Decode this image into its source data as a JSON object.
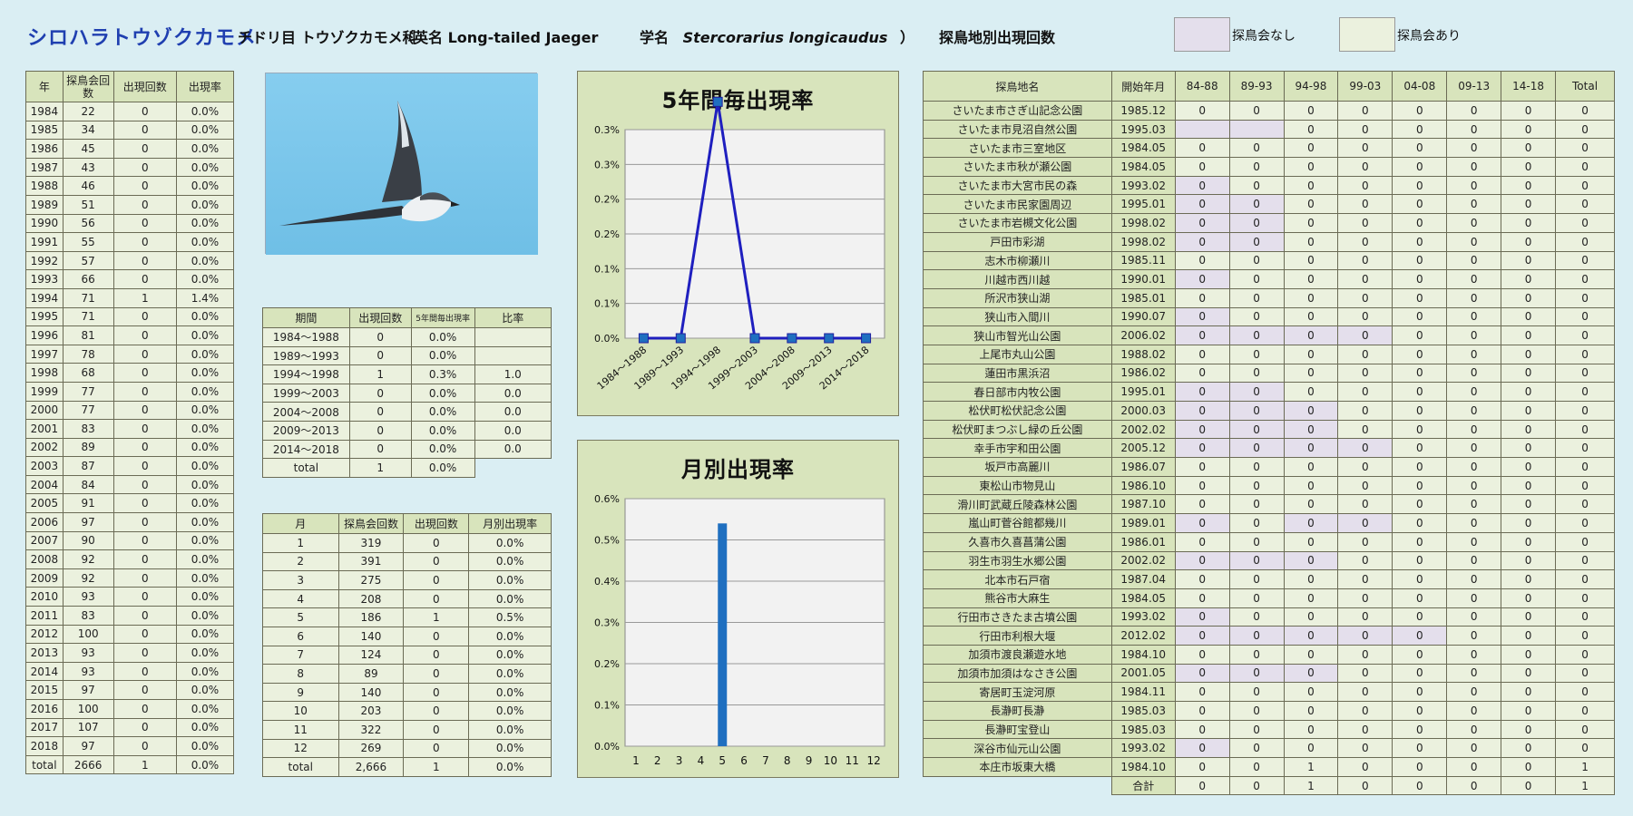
{
  "header": {
    "title": "シロハラトウゾクカモメ",
    "order": "チドリ目 トウゾクカモメ科",
    "english_prefix": "（英名 Long-tailed Jaeger",
    "scientific_prefix": "学名",
    "scientific_name": "Stercorarius longicaudus",
    "scientific_suffix": "）",
    "site_section_title": "探鳥地別出現回数",
    "legend_no_meeting": "探鳥会なし",
    "legend_meeting": "探鳥会あり"
  },
  "colors": {
    "header_green": "#d8e4bc",
    "body_green": "#ebf1de",
    "no_meeting_purple": "#e4dfec",
    "line_blue": "#1f1fbf",
    "bar_blue": "#1f6fc0",
    "background": "#daeef3"
  },
  "year_table": {
    "headers": [
      "年",
      "探鳥会回数",
      "出現回数",
      "出現率"
    ],
    "rows": [
      [
        "1984",
        "22",
        "0",
        "0.0%"
      ],
      [
        "1985",
        "34",
        "0",
        "0.0%"
      ],
      [
        "1986",
        "45",
        "0",
        "0.0%"
      ],
      [
        "1987",
        "43",
        "0",
        "0.0%"
      ],
      [
        "1988",
        "46",
        "0",
        "0.0%"
      ],
      [
        "1989",
        "51",
        "0",
        "0.0%"
      ],
      [
        "1990",
        "56",
        "0",
        "0.0%"
      ],
      [
        "1991",
        "55",
        "0",
        "0.0%"
      ],
      [
        "1992",
        "57",
        "0",
        "0.0%"
      ],
      [
        "1993",
        "66",
        "0",
        "0.0%"
      ],
      [
        "1994",
        "71",
        "1",
        "1.4%"
      ],
      [
        "1995",
        "71",
        "0",
        "0.0%"
      ],
      [
        "1996",
        "81",
        "0",
        "0.0%"
      ],
      [
        "1997",
        "78",
        "0",
        "0.0%"
      ],
      [
        "1998",
        "68",
        "0",
        "0.0%"
      ],
      [
        "1999",
        "77",
        "0",
        "0.0%"
      ],
      [
        "2000",
        "77",
        "0",
        "0.0%"
      ],
      [
        "2001",
        "83",
        "0",
        "0.0%"
      ],
      [
        "2002",
        "89",
        "0",
        "0.0%"
      ],
      [
        "2003",
        "87",
        "0",
        "0.0%"
      ],
      [
        "2004",
        "84",
        "0",
        "0.0%"
      ],
      [
        "2005",
        "91",
        "0",
        "0.0%"
      ],
      [
        "2006",
        "97",
        "0",
        "0.0%"
      ],
      [
        "2007",
        "90",
        "0",
        "0.0%"
      ],
      [
        "2008",
        "92",
        "0",
        "0.0%"
      ],
      [
        "2009",
        "92",
        "0",
        "0.0%"
      ],
      [
        "2010",
        "93",
        "0",
        "0.0%"
      ],
      [
        "2011",
        "83",
        "0",
        "0.0%"
      ],
      [
        "2012",
        "100",
        "0",
        "0.0%"
      ],
      [
        "2013",
        "93",
        "0",
        "0.0%"
      ],
      [
        "2014",
        "93",
        "0",
        "0.0%"
      ],
      [
        "2015",
        "97",
        "0",
        "0.0%"
      ],
      [
        "2016",
        "100",
        "0",
        "0.0%"
      ],
      [
        "2017",
        "107",
        "0",
        "0.0%"
      ],
      [
        "2018",
        "97",
        "0",
        "0.0%"
      ],
      [
        "total",
        "2666",
        "1",
        "0.0%"
      ]
    ]
  },
  "period_table": {
    "headers": [
      "期間",
      "出現回数",
      "5年間毎出現率",
      "比率"
    ],
    "rows": [
      [
        "1984～1988",
        "0",
        "0.0%",
        ""
      ],
      [
        "1989～1993",
        "0",
        "0.0%",
        ""
      ],
      [
        "1994～1998",
        "1",
        "0.3%",
        "1.0"
      ],
      [
        "1999～2003",
        "0",
        "0.0%",
        "0.0"
      ],
      [
        "2004～2008",
        "0",
        "0.0%",
        "0.0"
      ],
      [
        "2009～2013",
        "0",
        "0.0%",
        "0.0"
      ],
      [
        "2014～2018",
        "0",
        "0.0%",
        "0.0"
      ]
    ],
    "total": [
      "total",
      "1",
      "0.0%"
    ]
  },
  "month_table": {
    "headers": [
      "月",
      "探鳥会回数",
      "出現回数",
      "月別出現率"
    ],
    "rows": [
      [
        "1",
        "319",
        "0",
        "0.0%"
      ],
      [
        "2",
        "391",
        "0",
        "0.0%"
      ],
      [
        "3",
        "275",
        "0",
        "0.0%"
      ],
      [
        "4",
        "208",
        "0",
        "0.0%"
      ],
      [
        "5",
        "186",
        "1",
        "0.5%"
      ],
      [
        "6",
        "140",
        "0",
        "0.0%"
      ],
      [
        "7",
        "124",
        "0",
        "0.0%"
      ],
      [
        "8",
        "89",
        "0",
        "0.0%"
      ],
      [
        "9",
        "140",
        "0",
        "0.0%"
      ],
      [
        "10",
        "203",
        "0",
        "0.0%"
      ],
      [
        "11",
        "322",
        "0",
        "0.0%"
      ],
      [
        "12",
        "269",
        "0",
        "0.0%"
      ],
      [
        "total",
        "2,666",
        "1",
        "0.0%"
      ]
    ]
  },
  "chart_data": [
    {
      "type": "line",
      "title": "5年間毎出現率",
      "categories": [
        "1984～1988",
        "1989～1993",
        "1994～1998",
        "1999～2003",
        "2004～2008",
        "2009～2013",
        "2014～2018"
      ],
      "values": [
        0.0,
        0.0,
        0.34,
        0.0,
        0.0,
        0.0,
        0.0
      ],
      "ylim": [
        0,
        0.3
      ],
      "yticks": [
        "0.0%",
        "0.1%",
        "0.1%",
        "0.2%",
        "0.2%",
        "0.3%",
        "0.3%"
      ],
      "ytick_values": [
        0,
        0.05,
        0.1,
        0.15,
        0.2,
        0.25,
        0.3
      ],
      "grid": true,
      "xlabel": "",
      "ylabel": ""
    },
    {
      "type": "bar",
      "title": "月別出現率",
      "categories": [
        "1",
        "2",
        "3",
        "4",
        "5",
        "6",
        "7",
        "8",
        "9",
        "10",
        "11",
        "12"
      ],
      "values": [
        0,
        0,
        0,
        0,
        0.54,
        0,
        0,
        0,
        0,
        0,
        0,
        0
      ],
      "ylim": [
        0,
        0.6
      ],
      "yticks": [
        "0.0%",
        "0.1%",
        "0.2%",
        "0.3%",
        "0.4%",
        "0.5%",
        "0.6%"
      ],
      "ytick_values": [
        0,
        0.1,
        0.2,
        0.3,
        0.4,
        0.5,
        0.6
      ],
      "grid": true,
      "xlabel": "",
      "ylabel": ""
    }
  ],
  "site_table": {
    "headers": [
      "探鳥地名",
      "開始年月",
      "84-88",
      "89-93",
      "94-98",
      "99-03",
      "04-08",
      "09-13",
      "14-18",
      "Total"
    ],
    "rows": [
      {
        "name": "さいたま市さぎ山記念公園",
        "start": "1985.12",
        "v": [
          "0",
          "0",
          "0",
          "0",
          "0",
          "0",
          "0",
          "0"
        ],
        "p": []
      },
      {
        "name": "さいたま市見沼自然公園",
        "start": "1995.03",
        "v": [
          "",
          "",
          "0",
          "0",
          "0",
          "0",
          "0",
          "0"
        ],
        "p": [
          0,
          1
        ]
      },
      {
        "name": "さいたま市三室地区",
        "start": "1984.05",
        "v": [
          "0",
          "0",
          "0",
          "0",
          "0",
          "0",
          "0",
          "0"
        ],
        "p": []
      },
      {
        "name": "さいたま市秋が瀬公園",
        "start": "1984.05",
        "v": [
          "0",
          "0",
          "0",
          "0",
          "0",
          "0",
          "0",
          "0"
        ],
        "p": []
      },
      {
        "name": "さいたま市大宮市民の森",
        "start": "1993.02",
        "v": [
          "0",
          "0",
          "0",
          "0",
          "0",
          "0",
          "0",
          "0"
        ],
        "p": [
          0
        ]
      },
      {
        "name": "さいたま市民家園周辺",
        "start": "1995.01",
        "v": [
          "0",
          "0",
          "0",
          "0",
          "0",
          "0",
          "0",
          "0"
        ],
        "p": [
          0,
          1
        ]
      },
      {
        "name": "さいたま市岩槻文化公園",
        "start": "1998.02",
        "v": [
          "0",
          "0",
          "0",
          "0",
          "0",
          "0",
          "0",
          "0"
        ],
        "p": [
          0,
          1
        ]
      },
      {
        "name": "戸田市彩湖",
        "start": "1998.02",
        "v": [
          "0",
          "0",
          "0",
          "0",
          "0",
          "0",
          "0",
          "0"
        ],
        "p": [
          0,
          1
        ]
      },
      {
        "name": "志木市柳瀬川",
        "start": "1985.11",
        "v": [
          "0",
          "0",
          "0",
          "0",
          "0",
          "0",
          "0",
          "0"
        ],
        "p": []
      },
      {
        "name": "川越市西川越",
        "start": "1990.01",
        "v": [
          "0",
          "0",
          "0",
          "0",
          "0",
          "0",
          "0",
          "0"
        ],
        "p": [
          0
        ]
      },
      {
        "name": "所沢市狭山湖",
        "start": "1985.01",
        "v": [
          "0",
          "0",
          "0",
          "0",
          "0",
          "0",
          "0",
          "0"
        ],
        "p": []
      },
      {
        "name": "狭山市入間川",
        "start": "1990.07",
        "v": [
          "0",
          "0",
          "0",
          "0",
          "0",
          "0",
          "0",
          "0"
        ],
        "p": [
          0
        ]
      },
      {
        "name": "狭山市智光山公園",
        "start": "2006.02",
        "v": [
          "0",
          "0",
          "0",
          "0",
          "0",
          "0",
          "0",
          "0"
        ],
        "p": [
          0,
          1,
          2,
          3
        ]
      },
      {
        "name": "上尾市丸山公園",
        "start": "1988.02",
        "v": [
          "0",
          "0",
          "0",
          "0",
          "0",
          "0",
          "0",
          "0"
        ],
        "p": []
      },
      {
        "name": "蓮田市黒浜沼",
        "start": "1986.02",
        "v": [
          "0",
          "0",
          "0",
          "0",
          "0",
          "0",
          "0",
          "0"
        ],
        "p": []
      },
      {
        "name": "春日部市内牧公園",
        "start": "1995.01",
        "v": [
          "0",
          "0",
          "0",
          "0",
          "0",
          "0",
          "0",
          "0"
        ],
        "p": [
          0,
          1
        ]
      },
      {
        "name": "松伏町松伏記念公園",
        "start": "2000.03",
        "v": [
          "0",
          "0",
          "0",
          "0",
          "0",
          "0",
          "0",
          "0"
        ],
        "p": [
          0,
          1,
          2
        ]
      },
      {
        "name": "松伏町まつぶし緑の丘公園",
        "start": "2002.02",
        "v": [
          "0",
          "0",
          "0",
          "0",
          "0",
          "0",
          "0",
          "0"
        ],
        "p": [
          0,
          1,
          2
        ]
      },
      {
        "name": "幸手市宇和田公園",
        "start": "2005.12",
        "v": [
          "0",
          "0",
          "0",
          "0",
          "0",
          "0",
          "0",
          "0"
        ],
        "p": [
          0,
          1,
          2,
          3
        ]
      },
      {
        "name": "坂戸市高麗川",
        "start": "1986.07",
        "v": [
          "0",
          "0",
          "0",
          "0",
          "0",
          "0",
          "0",
          "0"
        ],
        "p": []
      },
      {
        "name": "東松山市物見山",
        "start": "1986.10",
        "v": [
          "0",
          "0",
          "0",
          "0",
          "0",
          "0",
          "0",
          "0"
        ],
        "p": []
      },
      {
        "name": "滑川町武蔵丘陵森林公園",
        "start": "1987.10",
        "v": [
          "0",
          "0",
          "0",
          "0",
          "0",
          "0",
          "0",
          "0"
        ],
        "p": []
      },
      {
        "name": "嵐山町菅谷館都幾川",
        "start": "1989.01",
        "v": [
          "0",
          "0",
          "0",
          "0",
          "0",
          "0",
          "0",
          "0"
        ],
        "p": [
          0,
          2,
          3
        ]
      },
      {
        "name": "久喜市久喜菖蒲公園",
        "start": "1986.01",
        "v": [
          "0",
          "0",
          "0",
          "0",
          "0",
          "0",
          "0",
          "0"
        ],
        "p": []
      },
      {
        "name": "羽生市羽生水郷公園",
        "start": "2002.02",
        "v": [
          "0",
          "0",
          "0",
          "0",
          "0",
          "0",
          "0",
          "0"
        ],
        "p": [
          0,
          1,
          2
        ]
      },
      {
        "name": "北本市石戸宿",
        "start": "1987.04",
        "v": [
          "0",
          "0",
          "0",
          "0",
          "0",
          "0",
          "0",
          "0"
        ],
        "p": []
      },
      {
        "name": "熊谷市大麻生",
        "start": "1984.05",
        "v": [
          "0",
          "0",
          "0",
          "0",
          "0",
          "0",
          "0",
          "0"
        ],
        "p": []
      },
      {
        "name": "行田市さきたま古墳公園",
        "start": "1993.02",
        "v": [
          "0",
          "0",
          "0",
          "0",
          "0",
          "0",
          "0",
          "0"
        ],
        "p": [
          0
        ]
      },
      {
        "name": "行田市利根大堰",
        "start": "2012.02",
        "v": [
          "0",
          "0",
          "0",
          "0",
          "0",
          "0",
          "0",
          "0"
        ],
        "p": [
          0,
          1,
          2,
          3,
          4
        ]
      },
      {
        "name": "加須市渡良瀬遊水地",
        "start": "1984.10",
        "v": [
          "0",
          "0",
          "0",
          "0",
          "0",
          "0",
          "0",
          "0"
        ],
        "p": []
      },
      {
        "name": "加須市加須はなさき公園",
        "start": "2001.05",
        "v": [
          "0",
          "0",
          "0",
          "0",
          "0",
          "0",
          "0",
          "0"
        ],
        "p": [
          0,
          1,
          2
        ]
      },
      {
        "name": "寄居町玉淀河原",
        "start": "1984.11",
        "v": [
          "0",
          "0",
          "0",
          "0",
          "0",
          "0",
          "0",
          "0"
        ],
        "p": []
      },
      {
        "name": "長瀞町長瀞",
        "start": "1985.03",
        "v": [
          "0",
          "0",
          "0",
          "0",
          "0",
          "0",
          "0",
          "0"
        ],
        "p": []
      },
      {
        "name": "長瀞町宝登山",
        "start": "1985.03",
        "v": [
          "0",
          "0",
          "0",
          "0",
          "0",
          "0",
          "0",
          "0"
        ],
        "p": []
      },
      {
        "name": "深谷市仙元山公園",
        "start": "1993.02",
        "v": [
          "0",
          "0",
          "0",
          "0",
          "0",
          "0",
          "0",
          "0"
        ],
        "p": [
          0
        ]
      },
      {
        "name": "本庄市坂東大橋",
        "start": "1984.10",
        "v": [
          "0",
          "0",
          "1",
          "0",
          "0",
          "0",
          "0",
          "1"
        ],
        "p": []
      }
    ],
    "total_label": "合計",
    "totals": [
      "0",
      "0",
      "1",
      "0",
      "0",
      "0",
      "0",
      "1"
    ]
  }
}
